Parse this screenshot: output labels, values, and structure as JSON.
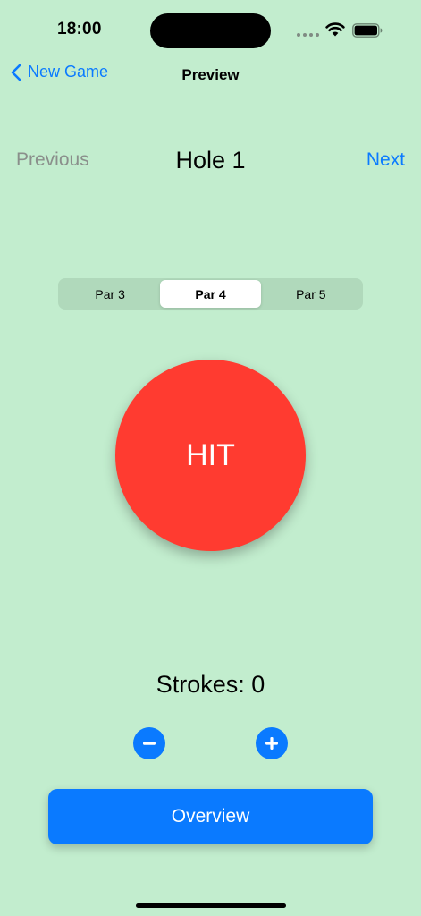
{
  "status_bar": {
    "time": "18:00"
  },
  "nav": {
    "back_label": "New Game",
    "title": "Preview"
  },
  "hole_nav": {
    "previous_label": "Previous",
    "title": "Hole 1",
    "next_label": "Next"
  },
  "par_selector": {
    "options": [
      "Par 3",
      "Par 4",
      "Par 5"
    ],
    "selected": "Par 4"
  },
  "hit_button": {
    "label": "HIT",
    "color": "#ff3b30"
  },
  "strokes": {
    "label": "Strokes: 0"
  },
  "stroke_controls": {
    "decrement_icon": "minus-circle-icon",
    "increment_icon": "plus-circle-icon"
  },
  "overview_button": {
    "label": "Overview"
  },
  "colors": {
    "background": "#c2edce",
    "accent": "#0a7aff",
    "disabled_text": "#8a8f8b"
  }
}
